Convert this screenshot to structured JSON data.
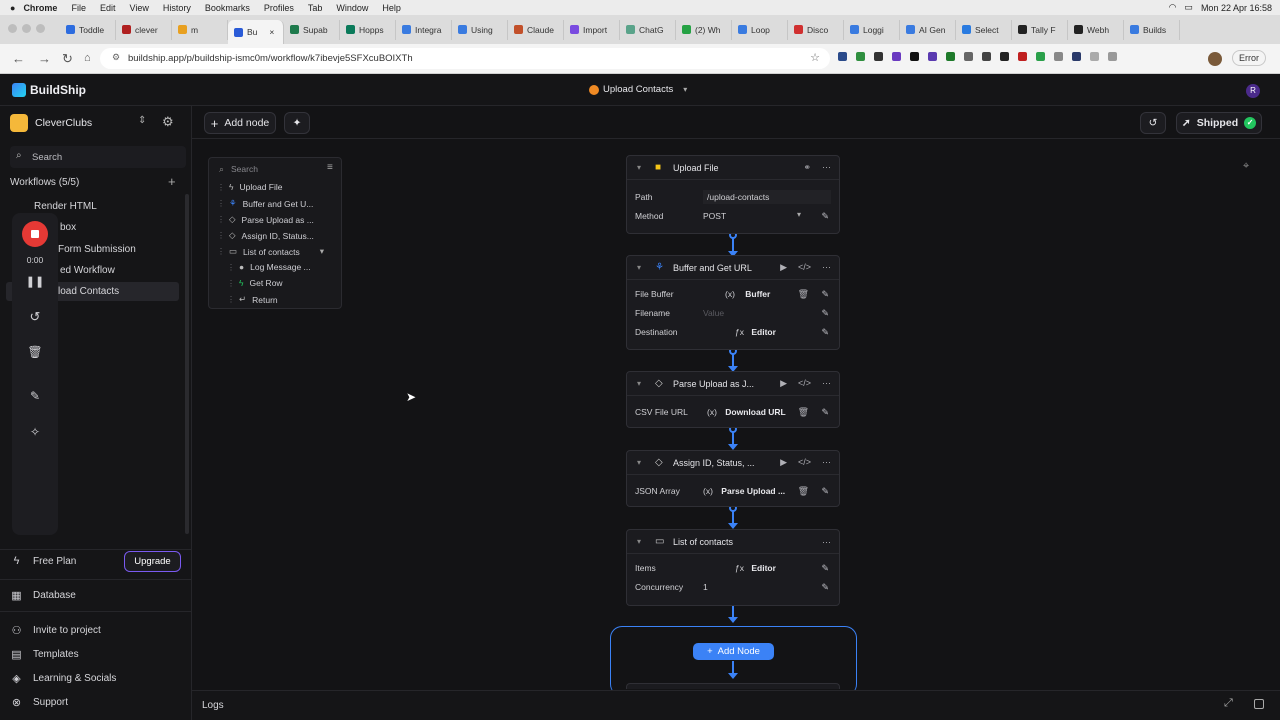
{
  "menubar": {
    "app": "Chrome",
    "items": [
      "File",
      "Edit",
      "View",
      "History",
      "Bookmarks",
      "Profiles",
      "Tab",
      "Window",
      "Help"
    ],
    "datetime": "Mon 22 Apr  16:58"
  },
  "tabs": [
    {
      "label": "Toddle",
      "color": "#2d6cdf"
    },
    {
      "label": "clever",
      "color": "#b02020"
    },
    {
      "label": "m",
      "color": "#e8a020"
    },
    {
      "label": "Bu",
      "color": "#2a5bd7",
      "active": true
    },
    {
      "label": "Supab",
      "color": "#1e7a4c"
    },
    {
      "label": "Hopps",
      "color": "#0a7a5a"
    },
    {
      "label": "Integra",
      "color": "#3a7be0"
    },
    {
      "label": "Using",
      "color": "#3a7be0"
    },
    {
      "label": "Claude",
      "color": "#c2502a"
    },
    {
      "label": "Import",
      "color": "#7a4be0"
    },
    {
      "label": "ChatG",
      "color": "#5aa38a"
    },
    {
      "label": "(2) Wh",
      "color": "#25a244"
    },
    {
      "label": "Loop",
      "color": "#3a7be0"
    },
    {
      "label": "Disco",
      "color": "#d03030"
    },
    {
      "label": "Loggi",
      "color": "#3a7be0"
    },
    {
      "label": "AI Gen",
      "color": "#3a7be0"
    },
    {
      "label": "Select",
      "color": "#2a7be0"
    },
    {
      "label": "Tally F",
      "color": "#222222"
    },
    {
      "label": "Webh",
      "color": "#222222"
    },
    {
      "label": "Builds",
      "color": "#3a7be0"
    }
  ],
  "address": {
    "url": "buildship.app/p/buildship-ismc0m/workflow/k7ibevje5SFXcuBOIXTh",
    "error_label": "Error"
  },
  "app": {
    "logo": "BuildShip",
    "workflow_title": "Upload Contacts",
    "avatar": "R",
    "status": "Shipped"
  },
  "sidebar": {
    "project": "CleverClubs",
    "search_placeholder": "Search",
    "workflows_label": "Workflows (5/5)",
    "workflows": [
      "Render HTML",
      "box",
      "Form Submission",
      "ed Workflow",
      "load Contacts"
    ],
    "plan": "Free Plan",
    "upgrade": "Upgrade",
    "database": "Database",
    "footer": [
      "Invite to project",
      "Templates",
      "Learning & Socials",
      "Support"
    ]
  },
  "recorder": {
    "time": "0:00"
  },
  "toolbar": {
    "add_node": "Add node"
  },
  "outline": {
    "search_placeholder": "Search",
    "items": [
      "Upload File",
      "Buffer and Get U...",
      "Parse Upload as ...",
      "Assign ID, Status...",
      "List of contacts",
      "Log Message ...",
      "Get Row",
      "Return"
    ]
  },
  "nodes": [
    {
      "title": "Upload File",
      "rows": [
        {
          "k": "Path",
          "v": "/upload-contacts"
        },
        {
          "k": "Method",
          "v": "POST"
        }
      ]
    },
    {
      "title": "Buffer and Get URL",
      "rows": [
        {
          "k": "File Buffer",
          "v": "Buffer"
        },
        {
          "k": "Filename",
          "v": "Value"
        },
        {
          "k": "Destination",
          "v": "Editor"
        }
      ]
    },
    {
      "title": "Parse Upload as J...",
      "rows": [
        {
          "k": "CSV File URL",
          "v": "Download URL"
        }
      ]
    },
    {
      "title": "Assign ID, Status, ...",
      "rows": [
        {
          "k": "JSON Array",
          "v": "Parse Upload ..."
        }
      ]
    },
    {
      "title": "List of contacts",
      "rows": [
        {
          "k": "Items",
          "v": "Editor"
        },
        {
          "k": "Concurrency",
          "v": "1"
        }
      ]
    }
  ],
  "add_node_loop": "Add Node",
  "bottom": {
    "logs": "Logs"
  }
}
